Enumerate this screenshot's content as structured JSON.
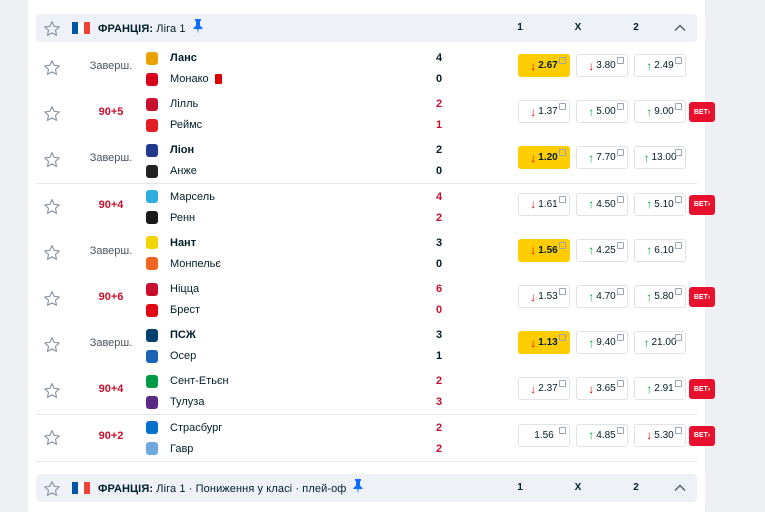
{
  "sections": [
    {
      "country": "ФРАНЦІЯ:",
      "league": "Ліга 1",
      "flag_colors": [
        "#0055a4",
        "#ffffff",
        "#ef4135"
      ],
      "col_1": "1",
      "col_x": "X",
      "col_2": "2",
      "icons": [
        "star-icon",
        "pin-icon",
        "chevron-up-icon"
      ]
    },
    {
      "country": "ФРАНЦІЯ:",
      "league": "Ліга 1 · Пониження у класі · плей-оф",
      "flag_colors": [
        "#0055a4",
        "#ffffff",
        "#ef4135"
      ],
      "col_1": "1",
      "col_x": "X",
      "col_2": "2",
      "icons": [
        "star-icon",
        "pin-icon",
        "chevron-up-icon"
      ]
    }
  ],
  "matches": [
    {
      "stage": "Заверш.",
      "live": false,
      "home": "Ланс",
      "home_score": "4",
      "home_win": true,
      "home_logo": "#e8a200",
      "away": "Монако",
      "away_score": "0",
      "away_logo": "#d6001c",
      "away_red_card": true,
      "odd1": "2.67",
      "odd1_dir": "down",
      "oddx": "3.80",
      "oddx_dir": "down",
      "odd2": "2.49",
      "odd2_dir": "up",
      "best": "1",
      "bet_badge": false
    },
    {
      "stage": "90+5",
      "live": true,
      "home": "Лілль",
      "home_score": "2",
      "home_win": false,
      "home_logo": "#c8102e",
      "away": "Реймс",
      "away_score": "1",
      "away_logo": "#e31b23",
      "odd1": "1.37",
      "odd1_dir": "down",
      "oddx": "5.00",
      "oddx_dir": "up",
      "odd2": "9.00",
      "odd2_dir": "up",
      "best": "",
      "bet_badge": true
    },
    {
      "stage": "Заверш.",
      "live": false,
      "home": "Ліон",
      "home_score": "2",
      "home_win": true,
      "home_logo": "#1f3a8a",
      "away": "Анже",
      "away_score": "0",
      "away_logo": "#222222",
      "odd1": "1.20",
      "odd1_dir": "down",
      "oddx": "7.70",
      "oddx_dir": "up",
      "odd2": "13.00",
      "odd2_dir": "up",
      "best": "1",
      "bet_badge": false
    },
    {
      "stage": "90+4",
      "live": true,
      "home": "Марсель",
      "home_score": "4",
      "home_win": false,
      "home_logo": "#2faee0",
      "away": "Ренн",
      "away_score": "2",
      "away_logo": "#1a1a1a",
      "odd1": "1.61",
      "odd1_dir": "down",
      "oddx": "4.50",
      "oddx_dir": "up",
      "odd2": "5.10",
      "odd2_dir": "up",
      "best": "",
      "bet_badge": true
    },
    {
      "stage": "Заверш.",
      "live": false,
      "home": "Нант",
      "home_score": "3",
      "home_win": true,
      "home_logo": "#f2d500",
      "away": "Монпельє",
      "away_score": "0",
      "away_logo": "#f26522",
      "odd1": "1.56",
      "odd1_dir": "down",
      "oddx": "4.25",
      "oddx_dir": "up",
      "odd2": "6.10",
      "odd2_dir": "up",
      "best": "1",
      "bet_badge": false
    },
    {
      "stage": "90+6",
      "live": true,
      "home": "Ніцца",
      "home_score": "6",
      "home_win": false,
      "home_logo": "#c8102e",
      "away": "Брест",
      "away_score": "0",
      "away_logo": "#e30613",
      "odd1": "1.53",
      "odd1_dir": "down",
      "oddx": "4.70",
      "oddx_dir": "up",
      "odd2": "5.80",
      "odd2_dir": "up",
      "best": "",
      "bet_badge": true
    },
    {
      "stage": "Заверш.",
      "live": false,
      "home": "ПСЖ",
      "home_score": "3",
      "home_win": true,
      "home_logo": "#004170",
      "away": "Осер",
      "away_score": "1",
      "away_logo": "#1b64b4",
      "odd1": "1.13",
      "odd1_dir": "down",
      "oddx": "9.40",
      "oddx_dir": "up",
      "odd2": "21.00",
      "odd2_dir": "up",
      "best": "1",
      "bet_badge": false
    },
    {
      "stage": "90+4",
      "live": true,
      "home": "Сент-Етьєн",
      "home_score": "2",
      "home_win": false,
      "home_logo": "#009a44",
      "away": "Тулуза",
      "away_score": "3",
      "away_logo": "#5b2a86",
      "odd1": "2.37",
      "odd1_dir": "down",
      "oddx": "3.65",
      "oddx_dir": "down",
      "odd2": "2.91",
      "odd2_dir": "up",
      "best": "",
      "bet_badge": true
    },
    {
      "stage": "90+2",
      "live": true,
      "home": "Страсбург",
      "home_score": "2",
      "home_win": false,
      "home_logo": "#0072ce",
      "away": "Гавр",
      "away_score": "2",
      "away_logo": "#6fa8dc",
      "odd1": "1.56",
      "odd1_dir": "",
      "oddx": "4.85",
      "oddx_dir": "up",
      "odd2": "5.30",
      "odd2_dir": "down",
      "best": "",
      "bet_badge": true
    }
  ],
  "bet_label": "BET›",
  "colors": {
    "live": "#c8102e",
    "best_odd": "#ffcd00",
    "up": "#00a83f",
    "down": "#dc0000",
    "bet": "#e8102d"
  }
}
